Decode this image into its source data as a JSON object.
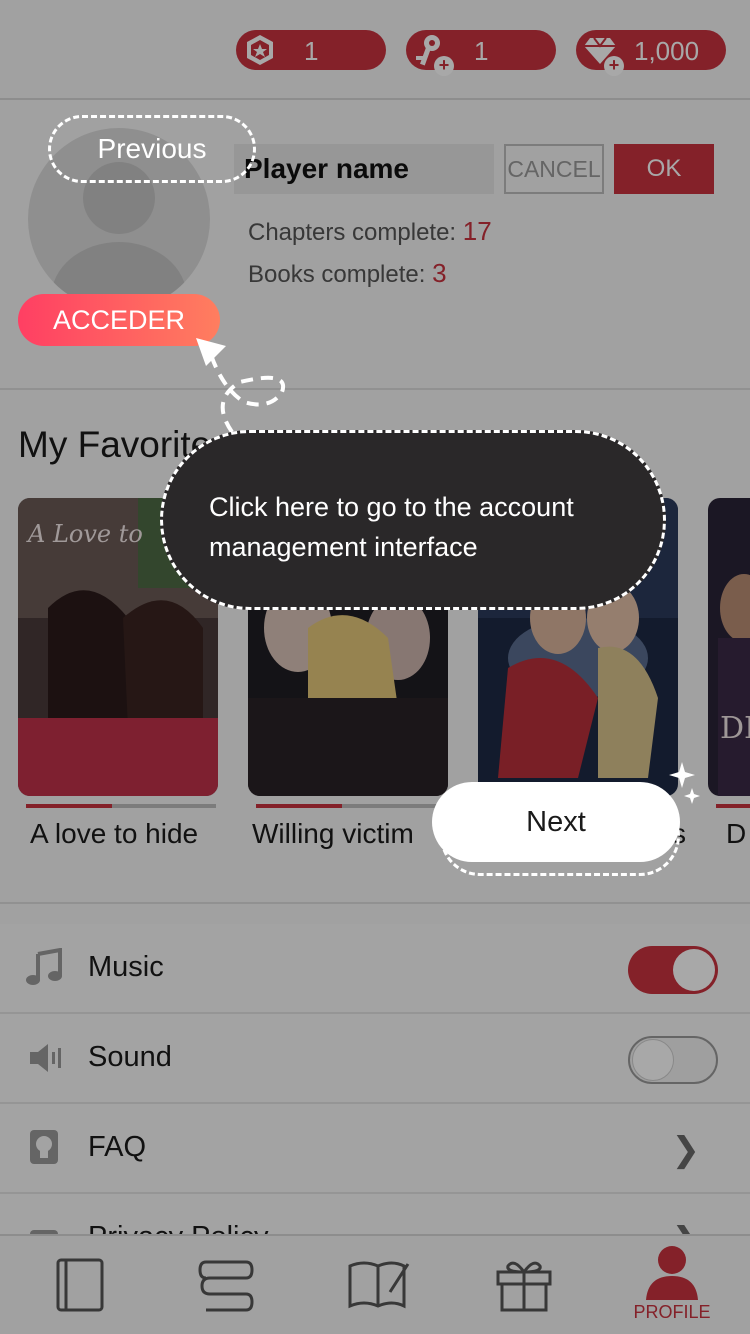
{
  "currency": {
    "tickets": "1",
    "keys": "1",
    "diamonds": "1,000"
  },
  "profile": {
    "player_name": "Player name",
    "cancel_label": "CANCEL",
    "ok_label": "OK",
    "chapters_label": "Chapters complete:",
    "chapters_value": "17",
    "books_label": "Books complete:",
    "books_value": "3",
    "acceder_label": "ACCEDER"
  },
  "favorites": {
    "title": "My Favorites",
    "books": [
      {
        "title": "A love to hide",
        "progress": 0.45
      },
      {
        "title": "Willing victim",
        "progress": 0.45
      },
      {
        "title": "s",
        "progress": 0.0
      },
      {
        "title": "D",
        "progress": 0.0
      }
    ]
  },
  "settings": {
    "music_label": "Music",
    "music_on": true,
    "sound_label": "Sound",
    "sound_on": false,
    "faq_label": "FAQ",
    "privacy_label": "Privacy Policy"
  },
  "bottom_nav": {
    "profile_label": "PROFILE"
  },
  "tutorial": {
    "previous_label": "Previous",
    "bubble_text": "Click here to go to the account management interface",
    "next_label": "Next"
  },
  "colors": {
    "accent": "#c8323f",
    "bubble": "#2a2829"
  }
}
